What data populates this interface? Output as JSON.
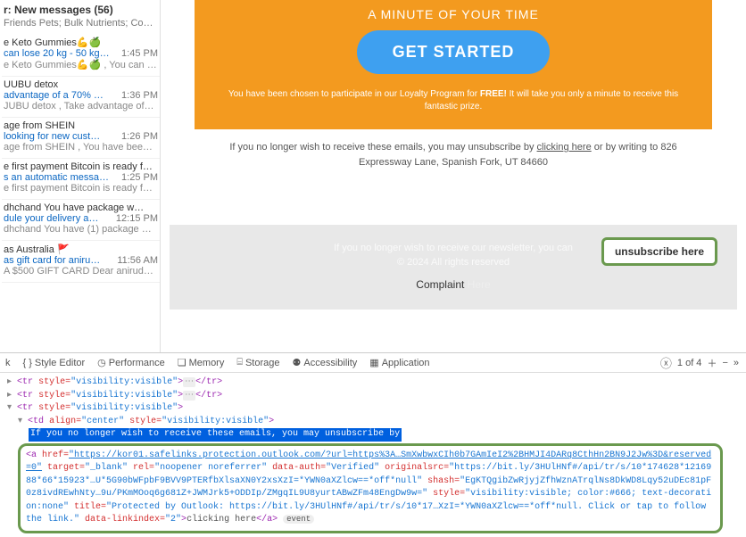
{
  "folder": {
    "header": "r: New messages (56)",
    "sub": "Friends Pets; Bulk Nutrients; Compa…"
  },
  "messages": [
    {
      "from": "e Keto Gummies💪🍏",
      "subject": "can lose 20 kg - 50 kg…",
      "time": "1:45 PM",
      "preview": "e Keto Gummies💪🍏 , You can l…"
    },
    {
      "from": "UUBU detox",
      "subject": "advantage of a 70% …",
      "time": "1:36 PM",
      "preview": "JUBU detox , Take advantage of…"
    },
    {
      "from": "age from SHEIN",
      "subject": "looking for new cust…",
      "time": "1:26 PM",
      "preview": "age from SHEIN , You have bee…"
    },
    {
      "from": "e first payment Bitcoin is ready f…",
      "subject": "s an automatic messa…",
      "time": "1:25 PM",
      "preview": "e first payment Bitcoin is ready f…"
    },
    {
      "from": "dhchand You have package w…",
      "subject": "dule your delivery a…",
      "time": "12:15 PM",
      "preview": "dhchand You have (1) package …"
    },
    {
      "from": "as Australia",
      "subject": "as gift card for aniru…",
      "time": "11:56 AM",
      "preview": "A $500 GIFT CARD Dear anirud…",
      "flag": "🚩"
    }
  ],
  "email": {
    "orange_title": "A MINUTE OF YOUR TIME",
    "cta": "GET STARTED",
    "loyalty1": "You have been chosen to participate in our Loyalty Program for ",
    "loyalty_free": "FREE!",
    "loyalty2": " It will take you only a minute to receive this fantastic prize.",
    "unsub_pre": "If you no longer wish to receive these emails, you may unsubscribe by ",
    "unsub_link": "clicking here",
    "unsub_post": " or by writing to  826 Expressway Lane, Spanish Fork, UT 84660",
    "footer_line1": "If you no longer wish to receive our newsletter, you can",
    "footer_btn": "unsubscribe here",
    "footer_line2": "© 2024 All rights reserved",
    "complaint": "Complaint",
    "complaint_here": "Here"
  },
  "devtools": {
    "tabs": {
      "k": "k",
      "style": "Style Editor",
      "perf": "Performance",
      "memory": "Memory",
      "storage": "Storage",
      "access": "Accessibility",
      "app": "Application"
    },
    "search": {
      "count": "1 of 4"
    },
    "html": {
      "l1a": "<tr",
      "l1b": " style=",
      "l1c": "\"visibility:visible\"",
      "l1d": ">",
      "l1e": "</tr>",
      "l4": "<td",
      "l4b": " align=",
      "l4c": "\"center\"",
      "l4d": " style=",
      "l4e": "\"visibility:visible\"",
      "l4f": ">",
      "sel": "If you no longer wish to receive these emails, you may unsubscribe by",
      "a_open": "<a",
      "href_a": " href=",
      "href_v": "\"https://kor01.safelinks.protection.outlook.com/?url=https%3A…SmXwbwxCIh0b7GAmIeI2%2BHMJI4DARq8CthHn2BN9J2Jw%3D&reserved=0\"",
      "target_a": " target=",
      "target_v": "\"_blank\"",
      "rel_a": " rel=",
      "rel_v": "\"noopener noreferrer\"",
      "dauth_a": " data-auth=",
      "dauth_v": "\"Verified\"",
      "orig_a": " originalsrc=",
      "orig_v": "\"https://bit.ly/3HUlHNf#/api/tr/s/10*174628*1216988*66*15923*…U*5G90bWFpbF9BVV9PTERfbXlsaXN0Y2xsXzI=*YWN0aXZlcw==*off*null\"",
      "shash_a": " shash=",
      "shash_v": "\"EgKTQgibZwRjyjZfhWznATrqlNs8DkWD8Lqy52uDEc81pF0z8ivdREwhNty…9u/PKmMOoq6g681Z+JWMJrk5+ODDIp/ZMgqIL9U8yurtABwZFm48EngDw9w=\"",
      "style_a": " style=",
      "style_v": "\"visibility:visible; color:#666; text-decoration:none\"",
      "title_a": " title=",
      "title_v": "\"Protected by Outlook: https://bit.ly/3HUlHNf#/api/tr/s/10*17…XzI=*YWN0aXZlcw==*off*null. Click or tap to follow the link.\"",
      "dli_a": " data-linkindex=",
      "dli_v": "\"2\"",
      "a_text": "clicking here",
      "a_close": "</a>",
      "event": "event"
    }
  }
}
